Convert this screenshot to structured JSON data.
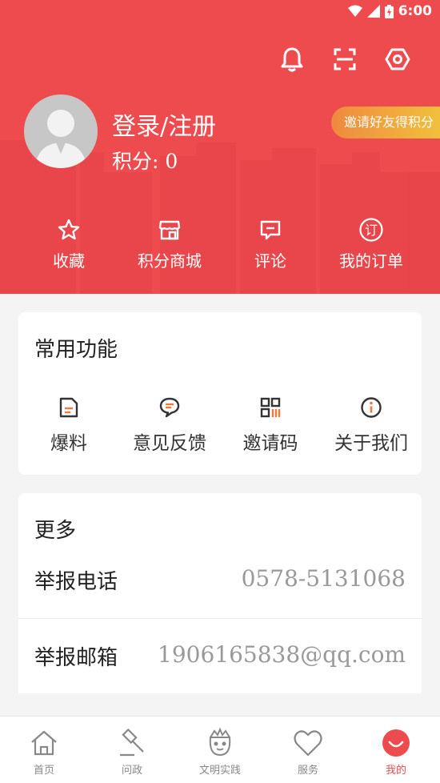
{
  "status_bar": {
    "time": "6:00"
  },
  "profile": {
    "login_label": "登录/注册",
    "points_label": "积分:",
    "points_value": "0",
    "invite_label": "邀请好友得积分"
  },
  "quick_actions": [
    {
      "label": "收藏",
      "icon": "star-icon"
    },
    {
      "label": "积分商城",
      "icon": "store-icon"
    },
    {
      "label": "评论",
      "icon": "comment-icon"
    },
    {
      "label": "我的订单",
      "icon": "order-icon"
    }
  ],
  "common_functions": {
    "title": "常用功能",
    "items": [
      {
        "label": "爆料",
        "icon": "report-doc-icon"
      },
      {
        "label": "意见反馈",
        "icon": "feedback-icon"
      },
      {
        "label": "邀请码",
        "icon": "qr-code-icon"
      },
      {
        "label": "关于我们",
        "icon": "info-icon"
      }
    ]
  },
  "more": {
    "title": "更多",
    "rows": [
      {
        "label": "举报电话",
        "value": "0578-5131068"
      },
      {
        "label": "举报邮箱",
        "value": "1906165838@qq.com"
      }
    ]
  },
  "tabbar": [
    {
      "label": "首页",
      "icon": "home-icon"
    },
    {
      "label": "问政",
      "icon": "gavel-icon"
    },
    {
      "label": "文明实践",
      "icon": "civilization-mascot-icon"
    },
    {
      "label": "服务",
      "icon": "heart-icon"
    },
    {
      "label": "我的",
      "icon": "me-smile-icon",
      "active": true
    }
  ],
  "colors": {
    "brand_red": "#ee4b4f",
    "accent_orange": "#f07a3a",
    "invite_gold": "#f2c33c"
  }
}
